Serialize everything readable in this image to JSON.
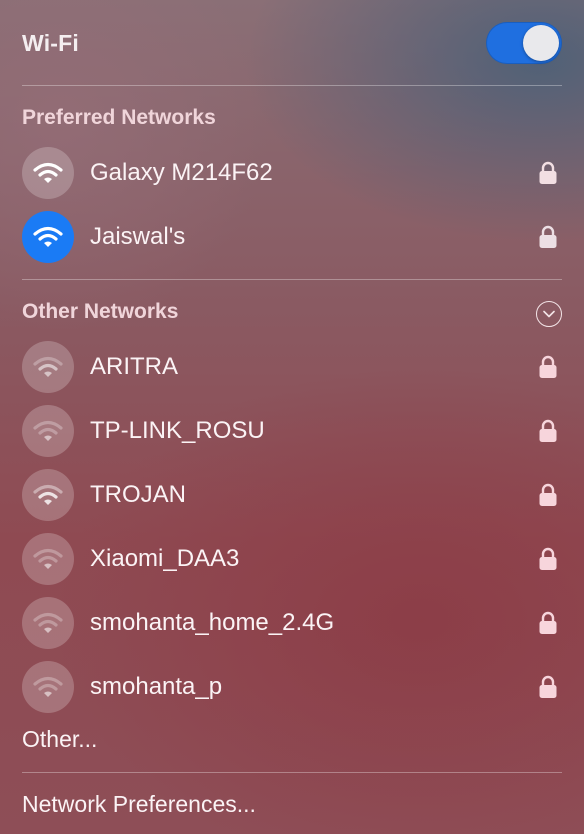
{
  "header": {
    "title": "Wi-Fi",
    "wifi_enabled": true
  },
  "preferred": {
    "label": "Preferred Networks",
    "networks": [
      {
        "name": "Galaxy M214F62",
        "locked": true,
        "connected": false
      },
      {
        "name": "Jaiswal's",
        "locked": true,
        "connected": true
      }
    ]
  },
  "other": {
    "label": "Other Networks",
    "networks": [
      {
        "name": "ARITRA",
        "locked": true
      },
      {
        "name": "TP-LINK_ROSU",
        "locked": true
      },
      {
        "name": "TROJAN",
        "locked": true
      },
      {
        "name": "Xiaomi_DAA3",
        "locked": true
      },
      {
        "name": "smohanta_home_2.4G",
        "locked": true
      },
      {
        "name": "smohanta_p",
        "locked": true
      }
    ]
  },
  "other_item": "Other...",
  "network_preferences": "Network Preferences...",
  "colors": {
    "toggle_on": "#1f6fe0",
    "active_network": "#1a7bf5"
  },
  "icons": {
    "wifi": "wifi-icon",
    "lock": "lock-icon",
    "expand": "chevron-circle-icon"
  }
}
